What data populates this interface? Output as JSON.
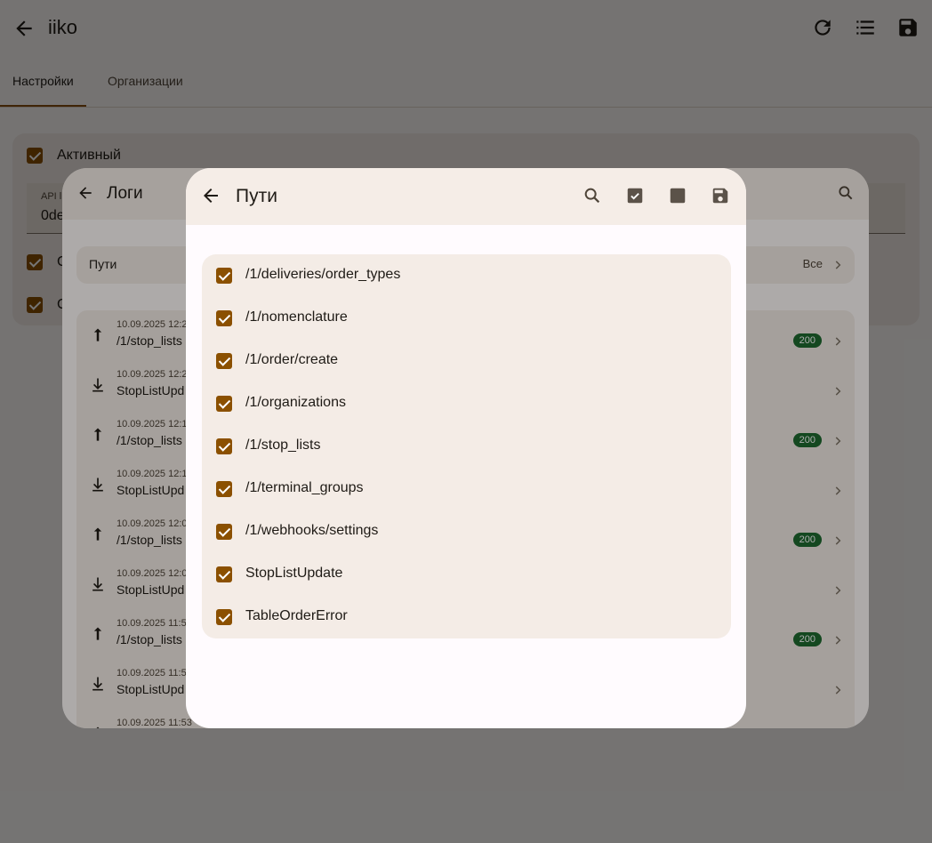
{
  "app": {
    "title": "iiko",
    "actions": [
      {
        "name": "refresh-icon"
      },
      {
        "name": "list-icon"
      },
      {
        "name": "save-icon"
      }
    ]
  },
  "tabs": [
    "Настройки",
    "Организации"
  ],
  "settings": {
    "active_label": "Активный",
    "active_checked": true,
    "api_field_label": "API l",
    "api_field_value": "0de",
    "extra_checkbox_labels": [
      "С",
      "С"
    ]
  },
  "logs_dialog": {
    "title": "Логи",
    "filter_label": "Пути",
    "filter_value": "Все",
    "items": [
      {
        "timestamp": "10.09.2025 12:2",
        "path": "/1/stop_lists",
        "direction": "up",
        "status": "200"
      },
      {
        "timestamp": "10.09.2025 12:2",
        "path": "StopListUpd",
        "direction": "down",
        "status": ""
      },
      {
        "timestamp": "10.09.2025 12:1",
        "path": "/1/stop_lists",
        "direction": "up",
        "status": "200"
      },
      {
        "timestamp": "10.09.2025 12:1",
        "path": "StopListUpd",
        "direction": "down",
        "status": ""
      },
      {
        "timestamp": "10.09.2025 12:0",
        "path": "/1/stop_lists",
        "direction": "up",
        "status": "200"
      },
      {
        "timestamp": "10.09.2025 12:0",
        "path": "StopListUpd",
        "direction": "down",
        "status": ""
      },
      {
        "timestamp": "10.09.2025 11:5",
        "path": "/1/stop_lists",
        "direction": "up",
        "status": "200"
      },
      {
        "timestamp": "10.09.2025 11:5",
        "path": "StopListUpd",
        "direction": "down",
        "status": ""
      },
      {
        "timestamp": "10.09.2025 11:53",
        "path": "",
        "direction": "up",
        "status": ""
      }
    ]
  },
  "paths_dialog": {
    "title": "Пути",
    "actions": [
      "search-icon",
      "select-all-icon",
      "deselect-all-icon",
      "save-icon"
    ],
    "items": [
      {
        "label": "/1/deliveries/order_types",
        "checked": true
      },
      {
        "label": "/1/nomenclature",
        "checked": true
      },
      {
        "label": "/1/order/create",
        "checked": true
      },
      {
        "label": "/1/organizations",
        "checked": true
      },
      {
        "label": "/1/stop_lists",
        "checked": true
      },
      {
        "label": "/1/terminal_groups",
        "checked": true
      },
      {
        "label": "/1/webhooks/settings",
        "checked": true
      },
      {
        "label": "StopListUpdate",
        "checked": true
      },
      {
        "label": "TableOrderError",
        "checked": true
      }
    ]
  },
  "colors": {
    "accent": "#8b5000",
    "status_ok": "#1e6a30",
    "surface": "#f4ece6",
    "header": "#f5ede7"
  }
}
